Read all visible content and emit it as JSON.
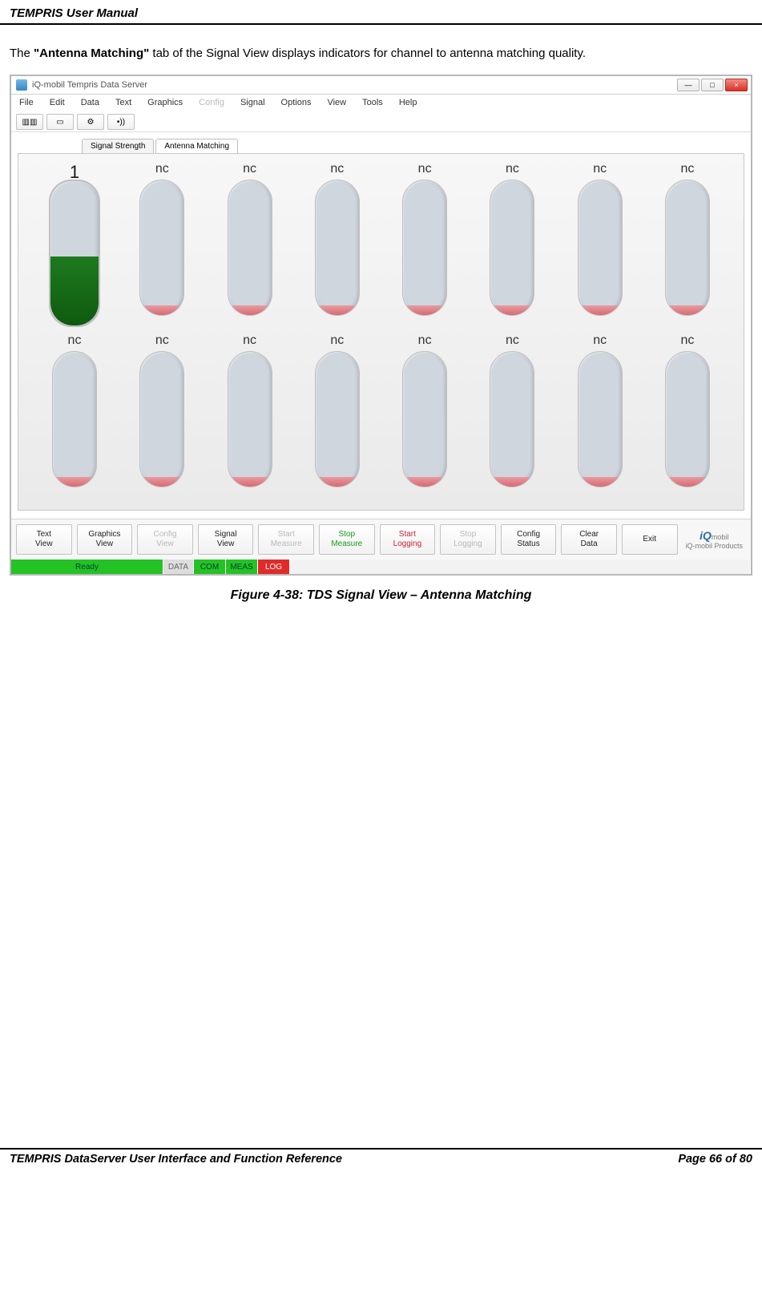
{
  "header": {
    "title": "TEMPRIS User Manual"
  },
  "paragraph": {
    "pre": "The ",
    "term": "\"Antenna Matching\"",
    "post": " tab of the Signal View displays indicators for channel to antenna matching quality."
  },
  "window": {
    "title": "iQ-mobil Tempris Data Server",
    "minimize": "—",
    "maximize": "□",
    "close": "×"
  },
  "menu": {
    "items": [
      "File",
      "Edit",
      "Data",
      "Text",
      "Graphics",
      "Config",
      "Signal",
      "Options",
      "View",
      "Tools",
      "Help"
    ],
    "disabled_indices": [
      5
    ]
  },
  "toolbar": {
    "btn1": "▥▥",
    "btn2": "▭",
    "btn3": "⚙",
    "btn4": "•))"
  },
  "subtabs": {
    "tab1": "Signal Strength",
    "tab2": "Antenna Matching",
    "active": 1
  },
  "gauges": {
    "row1": [
      "1",
      "nc",
      "nc",
      "nc",
      "nc",
      "nc",
      "nc",
      "nc"
    ],
    "row2": [
      "nc",
      "nc",
      "nc",
      "nc",
      "nc",
      "nc",
      "nc",
      "nc"
    ],
    "first_is_big": true
  },
  "buttons": {
    "b1": "Text\nView",
    "b2": "Graphics\nView",
    "b3": "Config\nView",
    "b4": "Signal\nView",
    "b5": "Start\nMeasure",
    "b6": "Stop\nMeasure",
    "b7": "Start\nLogging",
    "b8": "Stop\nLogging",
    "b9": "Config\nStatus",
    "b10": "Clear\nData",
    "b11": "Exit"
  },
  "logo": {
    "brand": "iQ",
    "suffix": "mobil",
    "tagline": "iQ-mobil Products"
  },
  "status": {
    "ready": "Ready",
    "data": "DATA",
    "com": "COM",
    "meas": "MEAS",
    "log": "LOG"
  },
  "caption": "Figure 4-38: TDS Signal View – Antenna Matching",
  "footer": {
    "left": "TEMPRIS DataServer User Interface and Function Reference",
    "right": "Page 66 of 80"
  }
}
